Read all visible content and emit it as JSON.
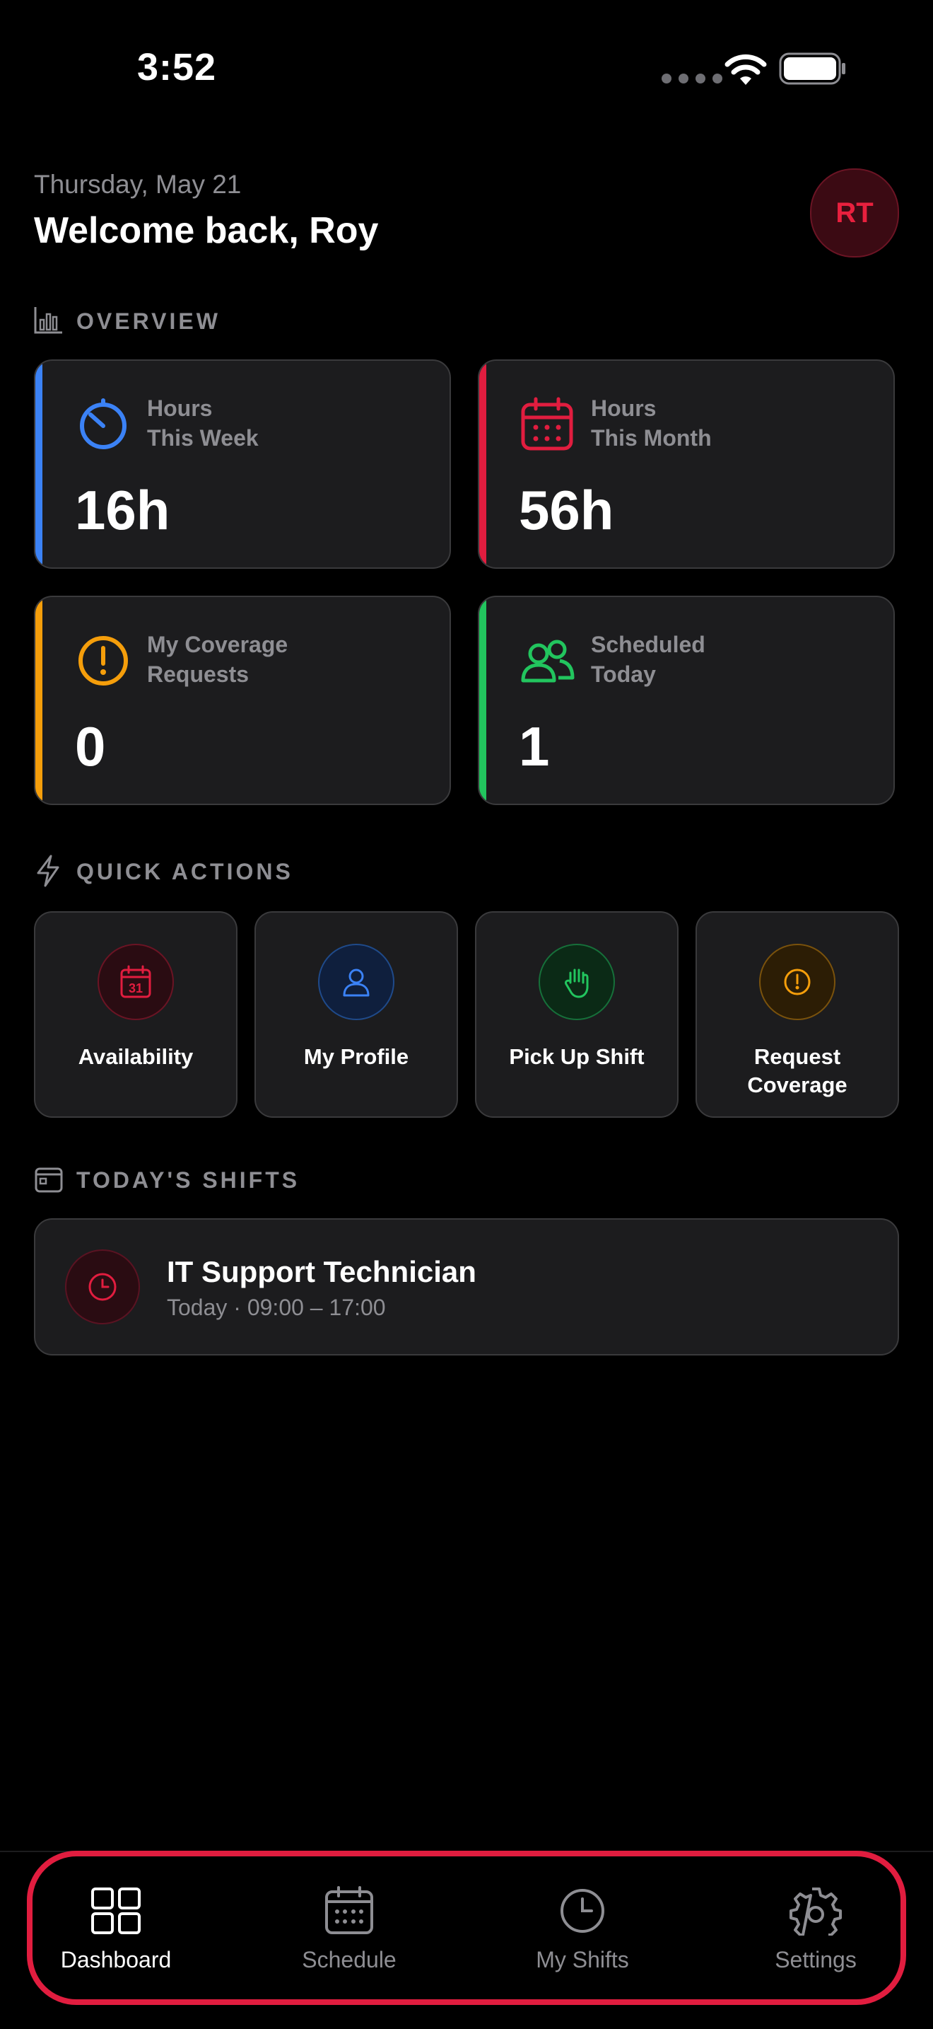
{
  "status_bar": {
    "time": "3:52"
  },
  "header": {
    "date": "Thursday, May 21",
    "welcome": "Welcome back, Roy",
    "avatar_initials": "RT"
  },
  "overview": {
    "title": "OVERVIEW",
    "cards": [
      {
        "label": "Hours\nThis Week",
        "value": "16h",
        "accent": "#3b82f6",
        "icon": "stopwatch-icon"
      },
      {
        "label": "Hours\nThis Month",
        "value": "56h",
        "accent": "#e11d3f",
        "icon": "calendar-icon"
      },
      {
        "label": "My Coverage\nRequests",
        "value": "0",
        "accent": "#f59e0b",
        "icon": "alert-circle-icon"
      },
      {
        "label": "Scheduled\nToday",
        "value": "1",
        "accent": "#22c55e",
        "icon": "users-icon"
      }
    ]
  },
  "quick_actions": {
    "title": "QUICK ACTIONS",
    "items": [
      {
        "label": "Availability",
        "color": "#e11d3f",
        "icon": "calendar-31-icon"
      },
      {
        "label": "My Profile",
        "color": "#3b82f6",
        "icon": "person-icon"
      },
      {
        "label": "Pick Up Shift",
        "color": "#22c55e",
        "icon": "hand-icon"
      },
      {
        "label": "Request\nCoverage",
        "color": "#f59e0b",
        "icon": "alert-circle-icon"
      }
    ]
  },
  "todays_shifts": {
    "title": "TODAY'S SHIFTS",
    "shifts": [
      {
        "title": "IT Support Technician",
        "subtitle": "Today · 09:00 – 17:00"
      }
    ]
  },
  "tab_bar": {
    "items": [
      {
        "label": "Dashboard",
        "icon": "grid-icon",
        "active": true
      },
      {
        "label": "Schedule",
        "icon": "calendar-icon",
        "active": false
      },
      {
        "label": "My Shifts",
        "icon": "clock-icon",
        "active": false
      },
      {
        "label": "Settings",
        "icon": "gear-icon",
        "active": false
      }
    ]
  },
  "colors": {
    "background": "#000000",
    "card": "#1c1c1e",
    "muted": "#8e8e93",
    "highlight": "#e11d3f"
  }
}
